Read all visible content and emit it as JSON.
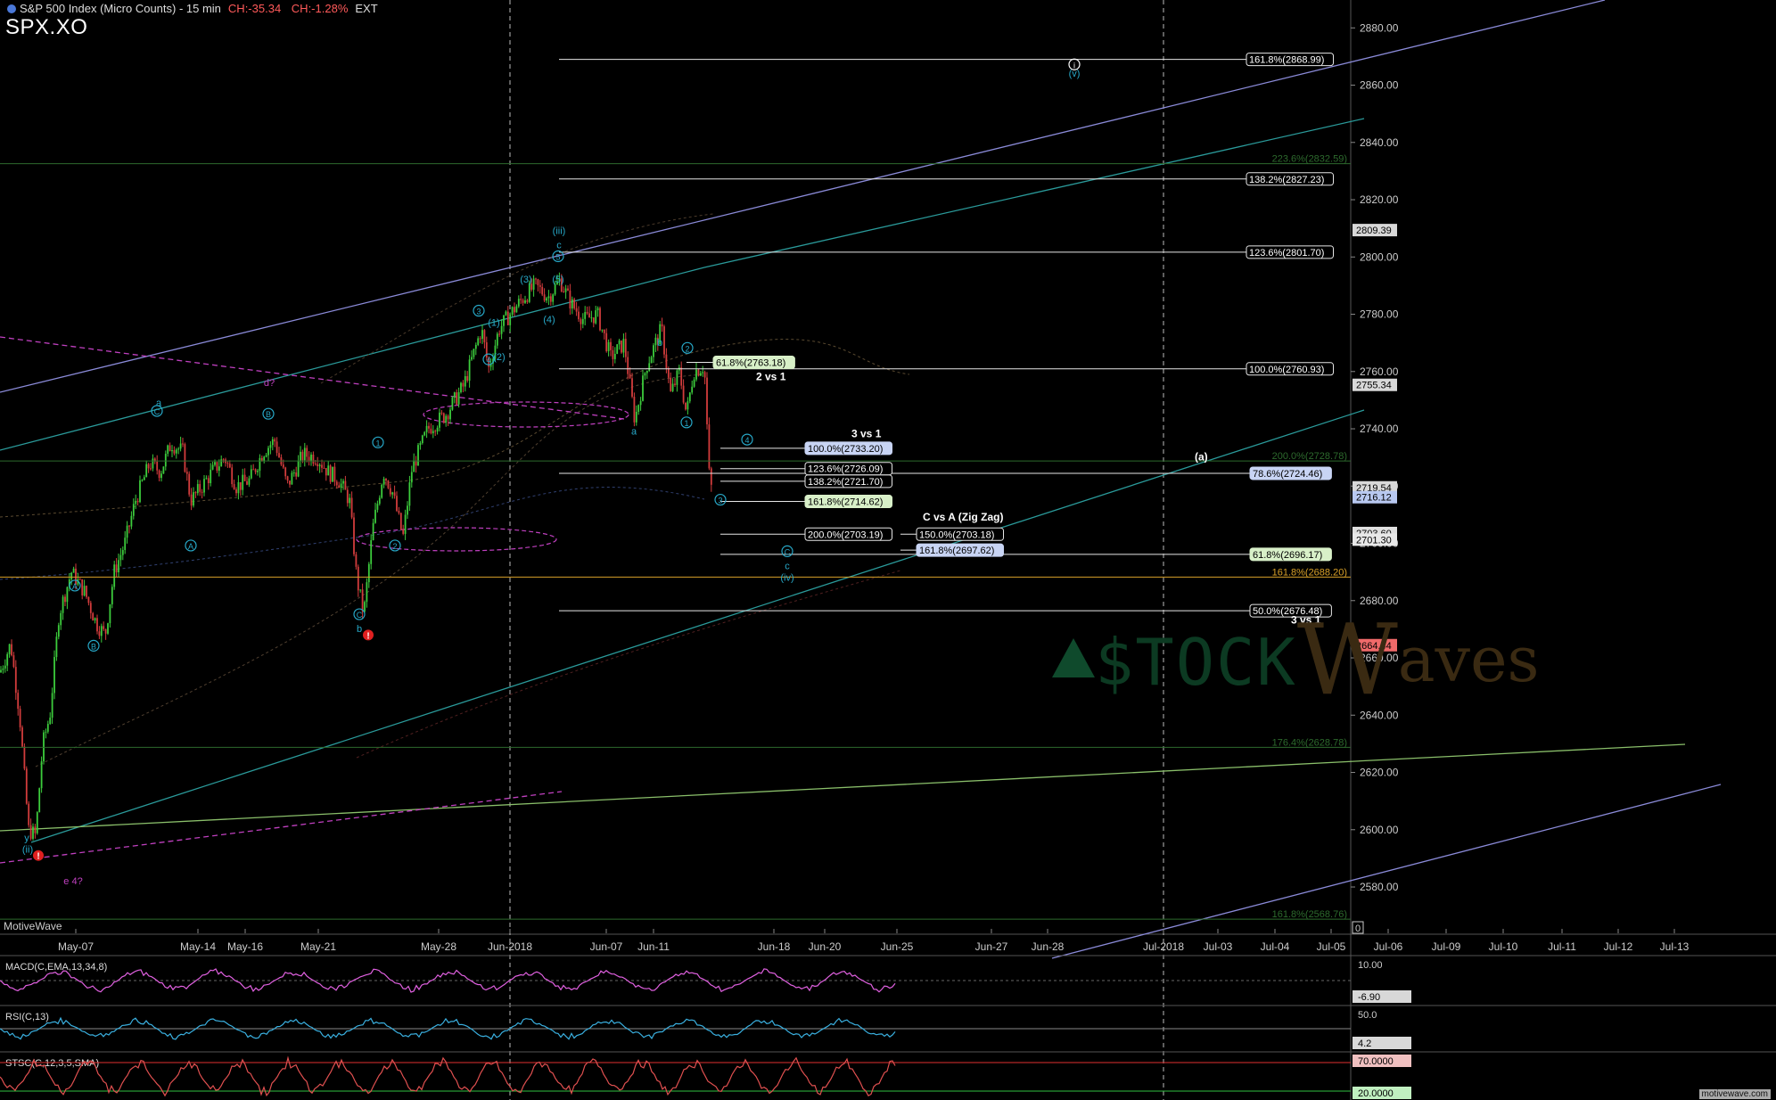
{
  "header": {
    "title": "S&P 500 Index (Micro Counts) - 15 min",
    "change_pts": "CH:-35.34",
    "change_pct": "CH:-1.28%",
    "session": "EXT",
    "symbol": "SPX.XO"
  },
  "watermark": {
    "stock": "$TOCK",
    "w": "W",
    "aves": "aves"
  },
  "footer": {
    "brand": "MotiveWave",
    "credit": "motivewave.com"
  },
  "colors": {
    "background": "#000000",
    "up_candle": "#3ccc3c",
    "down_candle": "#d23c3c",
    "fib_line": "#e6e6e6",
    "channel_blue": "#8a8ad8",
    "channel_teal": "#2a9a9a",
    "fib_green": "#2d6a2d",
    "fib_orange": "#d8a028",
    "magenta": "#c040c0",
    "wave_cyan": "#27a8c8",
    "macd": "#e060e0",
    "rsi": "#3ab0e0",
    "stoch": "#e05050"
  },
  "chart_data": {
    "type": "line",
    "title": "S&P 500 Index (Micro Counts) - 15 min",
    "price_axis": {
      "ylim": [
        2566,
        2886
      ],
      "ticks": [
        2580,
        2600,
        2620,
        2640,
        2660,
        2680,
        2700,
        2720,
        2740,
        2760,
        2780,
        2800,
        2820,
        2840,
        2860,
        2880
      ],
      "last_labels": [
        {
          "value": 2809.39,
          "text": "2809.39",
          "bg": "#d8d8d8"
        },
        {
          "value": 2755.34,
          "text": "2755.34",
          "bg": "#d8d8d8"
        },
        {
          "value": 2719.54,
          "text": "2719.54",
          "bg": "#d8d8d8"
        },
        {
          "value": 2716.12,
          "text": "2716.12",
          "bg": "#b8c8f0"
        },
        {
          "value": 2703.6,
          "text": "2703.60",
          "bg": "#e0e0e0"
        },
        {
          "value": 2701.3,
          "text": "2701.30",
          "bg": "#e8e8e8"
        },
        {
          "value": 2664.44,
          "text": "2664.44",
          "bg": "#f06a6a"
        }
      ]
    },
    "x_axis": {
      "dates": [
        "May-07",
        "May-14",
        "May-16",
        "May-21",
        "May-28",
        "Jun-2018",
        "Jun-07",
        "Jun-11",
        "Jun-18",
        "Jun-20",
        "Jun-25",
        "Jun-27",
        "Jun-28",
        "Jul-2018",
        "Jul-03",
        "Jul-04",
        "Jul-05",
        "Jul-06",
        "Jul-09",
        "Jul-10",
        "Jul-11",
        "Jul-12",
        "Jul-13"
      ],
      "separators": [
        "Jun-2018",
        "Jul-2018"
      ],
      "right_marker": "0"
    },
    "price_series": [
      [
        0,
        2655
      ],
      [
        12,
        2665
      ],
      [
        22,
        2640
      ],
      [
        32,
        2600
      ],
      [
        40,
        2598
      ],
      [
        48,
        2630
      ],
      [
        56,
        2640
      ],
      [
        66,
        2675
      ],
      [
        80,
        2690
      ],
      [
        95,
        2683
      ],
      [
        108,
        2672
      ],
      [
        118,
        2668
      ],
      [
        128,
        2690
      ],
      [
        140,
        2700
      ],
      [
        152,
        2715
      ],
      [
        168,
        2728
      ],
      [
        180,
        2725
      ],
      [
        192,
        2735
      ],
      [
        205,
        2732
      ],
      [
        214,
        2715
      ],
      [
        222,
        2718
      ],
      [
        238,
        2725
      ],
      [
        252,
        2730
      ],
      [
        265,
        2720
      ],
      [
        280,
        2722
      ],
      [
        295,
        2732
      ],
      [
        308,
        2736
      ],
      [
        322,
        2720
      ],
      [
        340,
        2731
      ],
      [
        356,
        2730
      ],
      [
        368,
        2725
      ],
      [
        380,
        2722
      ],
      [
        392,
        2715
      ],
      [
        400,
        2688
      ],
      [
        408,
        2675
      ],
      [
        418,
        2705
      ],
      [
        430,
        2725
      ],
      [
        440,
        2718
      ],
      [
        452,
        2702
      ],
      [
        462,
        2726
      ],
      [
        480,
        2740
      ],
      [
        500,
        2745
      ],
      [
        520,
        2755
      ],
      [
        540,
        2775
      ],
      [
        548,
        2761
      ],
      [
        560,
        2775
      ],
      [
        572,
        2780
      ],
      [
        585,
        2785
      ],
      [
        600,
        2790
      ],
      [
        615,
        2786
      ],
      [
        628,
        2792
      ],
      [
        640,
        2784
      ],
      [
        655,
        2778
      ],
      [
        670,
        2780
      ],
      [
        685,
        2765
      ],
      [
        700,
        2770
      ],
      [
        712,
        2743
      ],
      [
        725,
        2762
      ],
      [
        742,
        2775
      ],
      [
        752,
        2752
      ],
      [
        762,
        2760
      ],
      [
        770,
        2745
      ],
      [
        778,
        2760
      ],
      [
        790,
        2762
      ],
      [
        796,
        2720
      ],
      [
        800,
        2719
      ]
    ],
    "fib_lines": [
      {
        "value": 2868.99,
        "label": "161.8%(2868.99)",
        "x0": 627,
        "x1": 1398,
        "style": "white"
      },
      {
        "value": 2827.23,
        "label": "138.2%(2827.23)",
        "x0": 627,
        "x1": 1398,
        "style": "white"
      },
      {
        "value": 2801.7,
        "label": "123.6%(2801.70)",
        "x0": 627,
        "x1": 1398,
        "style": "white"
      },
      {
        "value": 2760.93,
        "label": "100.0%(2760.93)",
        "x0": 627,
        "x1": 1398,
        "style": "white"
      },
      {
        "value": 2724.46,
        "label": "78.6%(2724.46)",
        "x0": 627,
        "x1": 1402,
        "style": "blue"
      },
      {
        "value": 2696.17,
        "label": "61.8%(2696.17)",
        "x0": 808,
        "x1": 1402,
        "style": "green"
      },
      {
        "value": 2676.48,
        "label": "50.0%(2676.48)",
        "x0": 627,
        "x1": 1402,
        "style": "white"
      },
      {
        "value": 2733.2,
        "label": "100.0%(2733.20)",
        "x0": 808,
        "x1": 903,
        "style": "blue"
      },
      {
        "value": 2726.09,
        "label": "123.6%(2726.09)",
        "x0": 808,
        "x1": 903,
        "style": "white"
      },
      {
        "value": 2721.7,
        "label": "138.2%(2721.70)",
        "x0": 808,
        "x1": 903,
        "style": "white"
      },
      {
        "value": 2714.62,
        "label": "161.8%(2714.62)",
        "x0": 808,
        "x1": 903,
        "style": "green"
      },
      {
        "value": 2703.19,
        "label": "200.0%(2703.19)",
        "x0": 808,
        "x1": 903,
        "style": "white"
      },
      {
        "value": 2703.18,
        "label": "150.0%(2703.18)",
        "x0": 1010,
        "x1": 1028,
        "style": "white"
      },
      {
        "value": 2697.62,
        "label": "161.8%(2697.62)",
        "x0": 1010,
        "x1": 1028,
        "style": "blue"
      },
      {
        "value": 2763.18,
        "label": "61.8%(2763.18)",
        "x0": 770,
        "x1": 800,
        "style": "green"
      }
    ],
    "green_fib_lines": [
      {
        "value": 2832.59,
        "label": "223.6%(2832.59)",
        "color": "#2d6a2d"
      },
      {
        "value": 2728.78,
        "label": "200.0%(2728.78)",
        "color": "#2d6a2d"
      },
      {
        "value": 2688.2,
        "label": "161.8%(2688.20)",
        "color": "#d8a028"
      },
      {
        "value": 2628.78,
        "label": "176.4%(2628.78)",
        "color": "#2d6a2d"
      },
      {
        "value": 2568.76,
        "label": "161.8%(2568.76)",
        "color": "#2d6a2d"
      }
    ],
    "text_annotations": [
      {
        "text": "2 vs 1",
        "x": 848,
        "value": 2757
      },
      {
        "text": "3 vs 1",
        "x": 955,
        "value": 2737
      },
      {
        "text": "C vs A (Zig Zag)",
        "x": 1035,
        "value": 2708
      },
      {
        "text": "3 vs 1",
        "x": 1448,
        "value": 2672
      },
      {
        "text": "(a)",
        "x": 1340,
        "value": 2729
      }
    ],
    "wave_labels": [
      {
        "text": "a",
        "x": 178,
        "value": 2748
      },
      {
        "text": "C",
        "x": 176,
        "value": 2745,
        "circle": true
      },
      {
        "text": "B",
        "x": 301,
        "value": 2744,
        "circle": true
      },
      {
        "text": "d?",
        "x": 302,
        "value": 2755,
        "color": "magenta"
      },
      {
        "text": "1",
        "x": 424,
        "value": 2734,
        "circle": true
      },
      {
        "text": "A",
        "x": 214,
        "value": 2698,
        "circle": true
      },
      {
        "text": "2",
        "x": 443,
        "value": 2698,
        "circle": true
      },
      {
        "text": "A",
        "x": 84,
        "value": 2684,
        "circle": true
      },
      {
        "text": "B",
        "x": 105,
        "value": 2663,
        "circle": true
      },
      {
        "text": "C",
        "x": 403,
        "value": 2674,
        "circle": true
      },
      {
        "text": "b",
        "x": 403,
        "value": 2669
      },
      {
        "text": "3",
        "x": 537,
        "value": 2780,
        "circle": true
      },
      {
        "text": "(1)",
        "x": 554,
        "value": 2776
      },
      {
        "text": "(2)",
        "x": 560,
        "value": 2764
      },
      {
        "text": "4",
        "x": 548,
        "value": 2763,
        "circle": true
      },
      {
        "text": "(3)",
        "x": 590,
        "value": 2791
      },
      {
        "text": "(4)",
        "x": 616,
        "value": 2777
      },
      {
        "text": "(5)",
        "x": 626,
        "value": 2791
      },
      {
        "text": "5",
        "x": 626,
        "value": 2799,
        "circle": true
      },
      {
        "text": "c",
        "x": 627,
        "value": 2803
      },
      {
        "text": "(iii)",
        "x": 627,
        "value": 2808
      },
      {
        "text": "b",
        "x": 740,
        "value": 2769
      },
      {
        "text": "2",
        "x": 771,
        "value": 2767,
        "circle": true
      },
      {
        "text": "a",
        "x": 711,
        "value": 2738
      },
      {
        "text": "1",
        "x": 770,
        "value": 2741,
        "circle": true
      },
      {
        "text": "4",
        "x": 838,
        "value": 2735,
        "circle": true
      },
      {
        "text": "3",
        "x": 808,
        "value": 2714,
        "circle": true
      },
      {
        "text": "C",
        "x": 883,
        "value": 2696,
        "circle": true
      },
      {
        "text": "c",
        "x": 883,
        "value": 2691
      },
      {
        "text": "(iv)",
        "x": 883,
        "value": 2687
      },
      {
        "text": "i",
        "x": 1205,
        "value": 2866,
        "circle": true,
        "color": "#ffffff"
      },
      {
        "text": "(v)",
        "x": 1205,
        "value": 2863
      },
      {
        "text": "y",
        "x": 30,
        "value": 2596
      },
      {
        "text": "(ii)",
        "x": 31,
        "value": 2592
      },
      {
        "text": "e 4?",
        "x": 82,
        "value": 2581,
        "color": "magenta"
      }
    ],
    "warning_marks": [
      {
        "x": 413,
        "value": 2668
      },
      {
        "x": 43,
        "value": 2591
      }
    ],
    "indicators": [
      {
        "name": "MACD(C,EMA,13,34,8)",
        "levels": [
          "10.00",
          "-6.90"
        ],
        "color": "#e060e0"
      },
      {
        "name": "RSI(C,13)",
        "levels": [
          "50.0",
          "4.2"
        ],
        "color": "#3ab0e0"
      },
      {
        "name": "STSC(C,12,3,5,SMA)",
        "levels": [
          "70.0000",
          "20.0000"
        ],
        "color": "#e05050"
      }
    ]
  }
}
